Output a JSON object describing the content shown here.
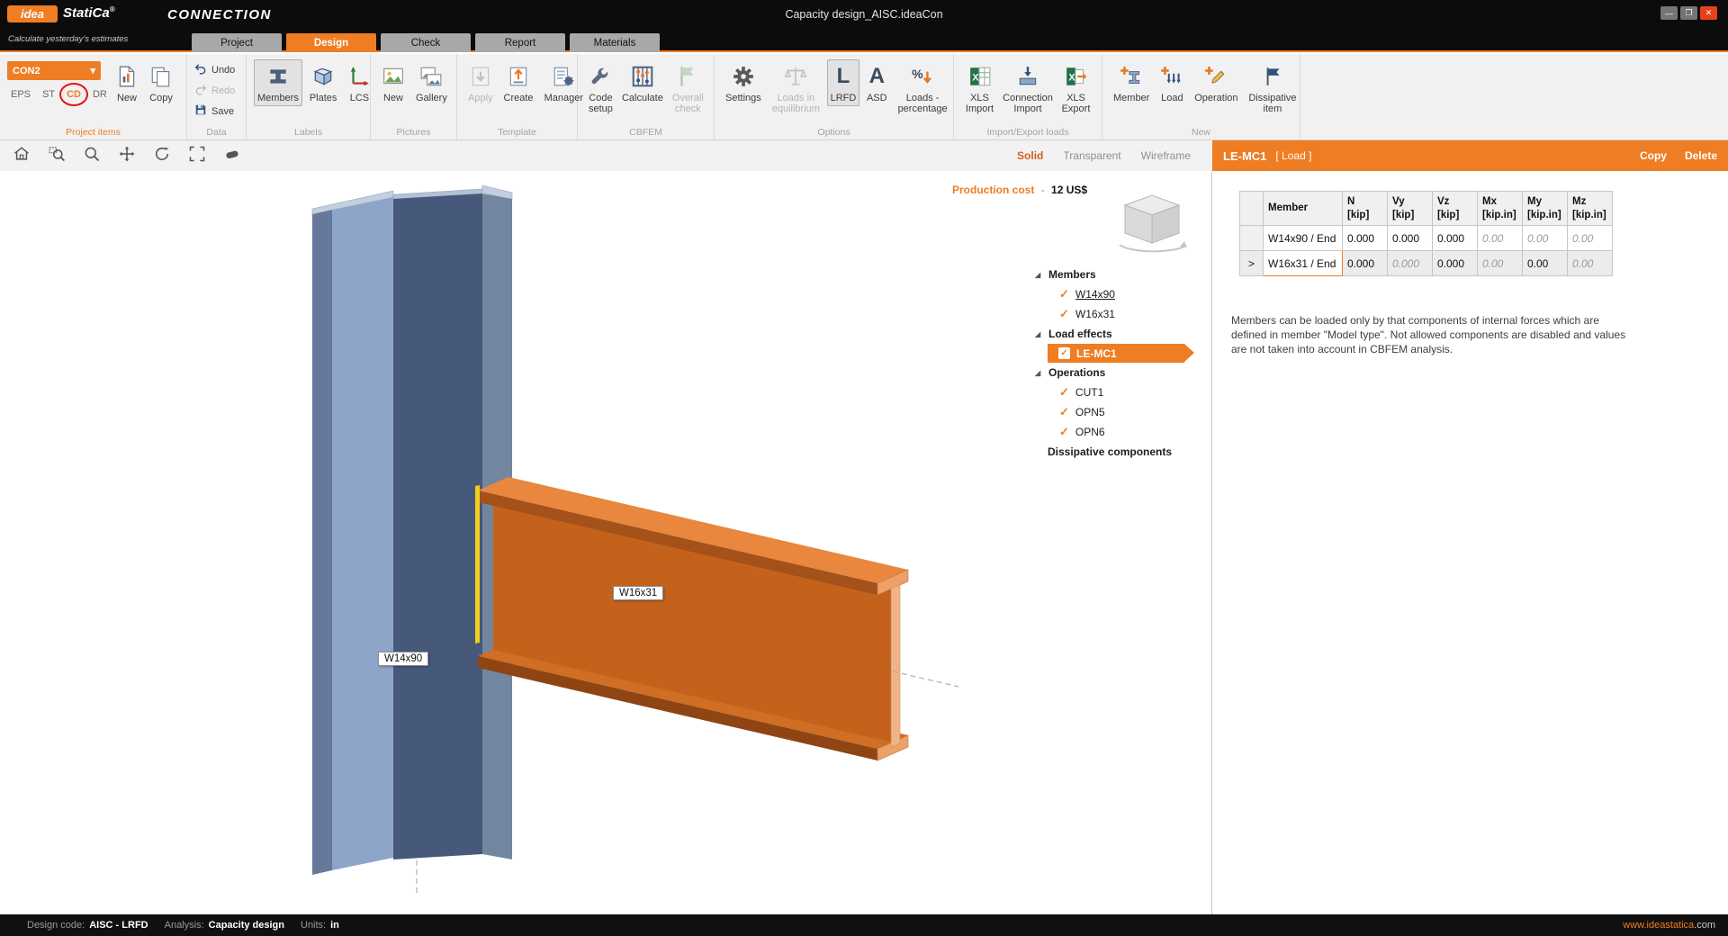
{
  "titlebar": {
    "logo_idea": "idea",
    "logo_statica": "StatiCa",
    "logo_reg": "®",
    "app_name": "CONNECTION",
    "tagline": "Calculate yesterday's estimates",
    "doc_title": "Capacity design_AISC.ideaCon",
    "window": {
      "minimize": "—",
      "maximize": "❐",
      "close": "✕"
    }
  },
  "tabs": {
    "project": "Project",
    "design": "Design",
    "check": "Check",
    "report": "Report",
    "materials": "Materials"
  },
  "ribbon": {
    "project_items": {
      "group_label": "Project items",
      "con_selector": "CON2",
      "con_caret": "▾",
      "eps": "EPS",
      "st": "ST",
      "cd": "CD",
      "dr": "DR",
      "new": "New",
      "copy": "Copy"
    },
    "data": {
      "group_label": "Data",
      "undo": "Undo",
      "redo": "Redo",
      "save": "Save"
    },
    "labels": {
      "group_label": "Labels",
      "members": "Members",
      "plates": "Plates",
      "lcs": "LCS"
    },
    "pictures": {
      "group_label": "Pictures",
      "new": "New",
      "gallery": "Gallery"
    },
    "template": {
      "group_label": "Template",
      "apply": "Apply",
      "create": "Create",
      "manager": "Manager"
    },
    "cbfem": {
      "group_label": "CBFEM",
      "code_setup": "Code setup",
      "calculate": "Calculate",
      "overall_check": "Overall check"
    },
    "options": {
      "group_label": "Options",
      "settings": "Settings",
      "loads_eq": "Loads in equilibrium",
      "lrfd": "LRFD",
      "lrfd_glyph": "L",
      "asd": "ASD",
      "asd_glyph": "A",
      "loads_pct": "Loads - percentage"
    },
    "import_export": {
      "group_label": "Import/Export loads",
      "xls_import": "XLS Import",
      "conn_import": "Connection Import",
      "xls_export": "XLS Export"
    },
    "new_group": {
      "group_label": "New",
      "member": "Member",
      "load": "Load",
      "operation": "Operation",
      "dissipative": "Dissipative item"
    }
  },
  "viewport_toolbar": {
    "modes": {
      "solid": "Solid",
      "transparent": "Transparent",
      "wireframe": "Wireframe"
    }
  },
  "scene": {
    "production_cost_label": "Production cost",
    "production_cost_sep": "-",
    "production_cost_value": "12 US$",
    "member_labels": {
      "column": "W14x90",
      "beam": "W16x31"
    }
  },
  "tree": {
    "members": {
      "header": "Members",
      "items": {
        "w14": "W14x90",
        "w16": "W16x31"
      },
      "check": "✓",
      "tri": "◢"
    },
    "load_effects": {
      "header": "Load effects",
      "selected": "LE-MC1",
      "check": "✓"
    },
    "operations": {
      "header": "Operations",
      "items": {
        "cut1": "CUT1",
        "opn5": "OPN5",
        "opn6": "OPN6"
      }
    },
    "dissipative": {
      "header": "Dissipative components"
    }
  },
  "panel": {
    "header": {
      "title": "LE-MC1",
      "subtitle": "[ Load ]",
      "copy": "Copy",
      "delete": "Delete"
    },
    "table": {
      "col_member": "Member",
      "cols": [
        {
          "n": "N",
          "u": "[kip]"
        },
        {
          "n": "Vy",
          "u": "[kip]"
        },
        {
          "n": "Vz",
          "u": "[kip]"
        },
        {
          "n": "Mx",
          "u": "[kip.in]"
        },
        {
          "n": "My",
          "u": "[kip.in]"
        },
        {
          "n": "Mz",
          "u": "[kip.in]"
        }
      ],
      "rows": [
        {
          "member": "W14x90 / End",
          "v": [
            "0.000",
            "0.000",
            "0.000",
            "0.00",
            "0.00",
            "0.00"
          ],
          "marker": ""
        },
        {
          "member": "W16x31 / End",
          "v": [
            "0.000",
            "0.000",
            "0.000",
            "0.00",
            "0.00",
            "0.00"
          ],
          "marker": ">"
        }
      ]
    },
    "note": "Members can be loaded only by that components of internal forces which are defined in member \"Model type\". Not allowed components are disabled and values are not taken into account in CBFEM analysis."
  },
  "statusbar": {
    "design_code_label": "Design code:",
    "design_code": "AISC - LRFD",
    "analysis_label": "Analysis:",
    "analysis": "Capacity design",
    "units_label": "Units:",
    "units": "in",
    "website_main": "www.ideastatica",
    "website_tld": ".com"
  },
  "icons": [
    "idea-logo",
    "minimize-icon",
    "maximize-icon",
    "close-icon",
    "dropdown-caret-icon",
    "document-new-icon",
    "document-copy-icon",
    "undo-icon",
    "redo-icon",
    "save-icon",
    "ibeam-icon",
    "plate-icon",
    "axes-icon",
    "photo-icon",
    "gallery-icon",
    "apply-icon",
    "create-icon",
    "manager-icon",
    "wrench-icon",
    "abacus-icon",
    "flag-check-icon",
    "gear-icon",
    "scales-icon",
    "percent-down-icon",
    "xls-import-icon",
    "connection-import-icon",
    "xls-export-icon",
    "member-add-icon",
    "load-add-icon",
    "operation-add-icon",
    "dissipative-flag-icon",
    "home-icon",
    "zoom-window-icon",
    "zoom-icon",
    "pan-icon",
    "rotate-icon",
    "fit-view-icon",
    "clip-icon",
    "expand-triangle-icon",
    "checkmark-icon",
    "nav-cube"
  ],
  "colors": {
    "accent": "#ee7d23",
    "steel_light": "#8da5c9",
    "steel_dark": "#46597a",
    "beam_orange": "#c4621c",
    "annotation_red": "#e51010"
  }
}
